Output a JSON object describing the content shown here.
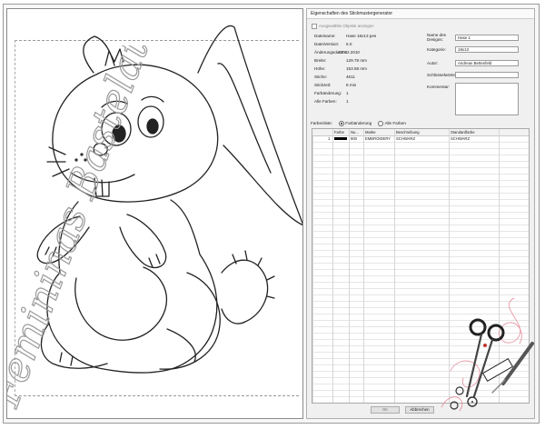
{
  "dialog": {
    "title": "Eigenschaften des Stickmustergenerator",
    "show_selected_label": "Ausgewählte Objekte anzeigen"
  },
  "info": {
    "dateiname": {
      "label": "Dateiname:",
      "value": "Hase 18x13 pes"
    },
    "dateiversion": {
      "label": "DateiVersion:",
      "value": "5.0"
    },
    "aenderungsdatum": {
      "label": "Änderungsdatum:",
      "value": "07.02.2010"
    },
    "breite": {
      "label": "Breite:",
      "value": "129.78 mm"
    },
    "hoehe": {
      "label": "Höhe:",
      "value": "153.58 mm"
    },
    "stiche": {
      "label": "Stiche:",
      "value": "4611"
    },
    "stickzeit": {
      "label": "Stickzeit:",
      "value": "8 min"
    },
    "farbaenderung": {
      "label": "Farbänderung:",
      "value": "1"
    },
    "alle_farben": {
      "label": "Alle Farben:",
      "value": "1"
    }
  },
  "fields": {
    "design_label": "Name des Designs:",
    "design_value": "Hase 1",
    "kategorie_label": "Kategorie:",
    "kategorie_value": "18x13",
    "autor_label": "Autor:",
    "autor_value": "Andreas Bettenfeld",
    "schluessel_label": "Schlüsselwörter:",
    "schluessel_value": "",
    "kommentar_label": "Kommentar:",
    "kommentar_value": ""
  },
  "color_list": {
    "label": "Farbenliste:",
    "option_change": "Farbänderung",
    "option_all": "Alle Farben",
    "selected": "Farbänderung",
    "headers": [
      "Farbe",
      "Nu...",
      "Marke",
      "Beschreibung",
      "Standardfarbe"
    ],
    "rows": [
      {
        "index": "1",
        "number": "900",
        "brand": "EMBROIDERY",
        "description": "SCHWARZ",
        "standard": "SCHWARZ",
        "color": "#000000"
      }
    ]
  },
  "buttons": {
    "ok": "OK",
    "cancel": "Abbrechen"
  },
  "watermark": {
    "text": "Femininas Bastelatelier"
  }
}
